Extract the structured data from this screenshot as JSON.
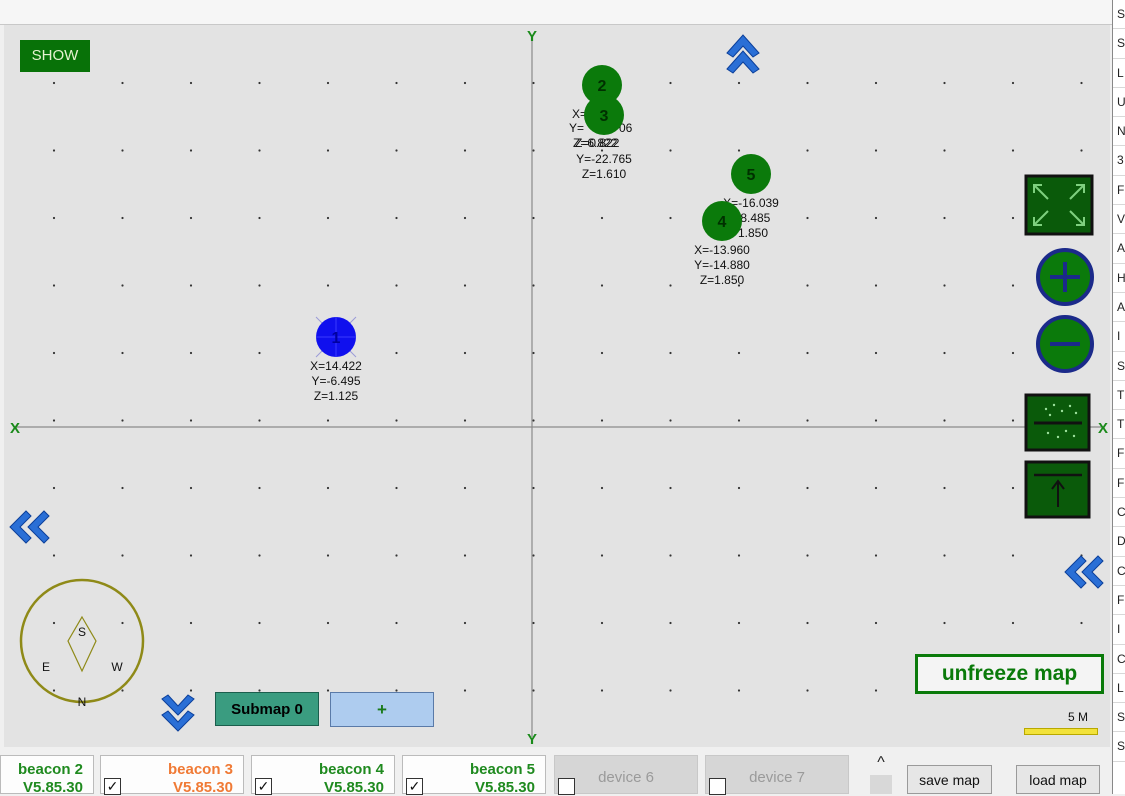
{
  "controls": {
    "show_label": "SHOW",
    "unfreeze_label": "unfreeze map",
    "submap_label": "Submap 0",
    "add_submap_label": "+",
    "scale_label": "5 M",
    "save_label": "save map",
    "load_label": "load map",
    "scroll_up_glyph": "^"
  },
  "axes": {
    "y_label": "Y",
    "x_label": "X"
  },
  "compass": {
    "north": "N",
    "south": "S",
    "east": "E",
    "west": "W"
  },
  "beacons": [
    {
      "id": "1",
      "lines": [
        "X=14.422",
        "Y=-6.495",
        "Z=1.125"
      ]
    },
    {
      "id": "2",
      "lines": [
        "X=",
        "Y=",
        "Z=6.822"
      ]
    },
    {
      "id": "3",
      "lines": [
        "Y=-22.765",
        "Z=1.610"
      ]
    },
    {
      "id": "4",
      "lines": [
        "X=-13.960",
        "Y=-14.880",
        "Z=1.850"
      ]
    },
    {
      "id": "5",
      "lines": [
        "X=-16.039",
        "18.485",
        "1.850"
      ]
    }
  ],
  "overlap_fragments": [
    "06",
    "Z=0.822"
  ],
  "devices": [
    {
      "name": "beacon 2",
      "version": "V5.85.30",
      "color": "#1f8a1f",
      "checkbox": false,
      "checked": false
    },
    {
      "name": "beacon 3",
      "version": "V5.85.30",
      "color": "#f07a35",
      "checkbox": true,
      "checked": true
    },
    {
      "name": "beacon 4",
      "version": "V5.85.30",
      "color": "#1f8a1f",
      "checkbox": true,
      "checked": true
    },
    {
      "name": "beacon 5",
      "version": "V5.85.30",
      "color": "#1f8a1f",
      "checkbox": true,
      "checked": true
    },
    {
      "name": "device 6",
      "disabled": true,
      "checkbox": true,
      "checked": false
    },
    {
      "name": "device 7",
      "disabled": true,
      "checkbox": true,
      "checked": false
    }
  ],
  "right_strip_letters": [
    "S",
    "S",
    "L",
    "U",
    "N",
    "3",
    "F",
    "V",
    "A",
    "H",
    "A",
    "I",
    "S",
    "T",
    "T",
    "F",
    "F",
    "C",
    "D",
    "C",
    "F",
    "I",
    "C",
    "L",
    "S",
    "S"
  ],
  "colors": {
    "beacon_green": "#0b7a0b",
    "anchor_blue": "#1010ee",
    "map_bg": "#e3e3e3",
    "chevron_blue": "#2a6fd6"
  },
  "icons": [
    "fit-screen-icon",
    "zoom-in-icon",
    "zoom-out-icon",
    "point-cloud-icon",
    "align-top-icon",
    "double-chevron-up-icon",
    "double-chevron-down-icon",
    "double-chevron-left-icon",
    "compass-icon"
  ]
}
